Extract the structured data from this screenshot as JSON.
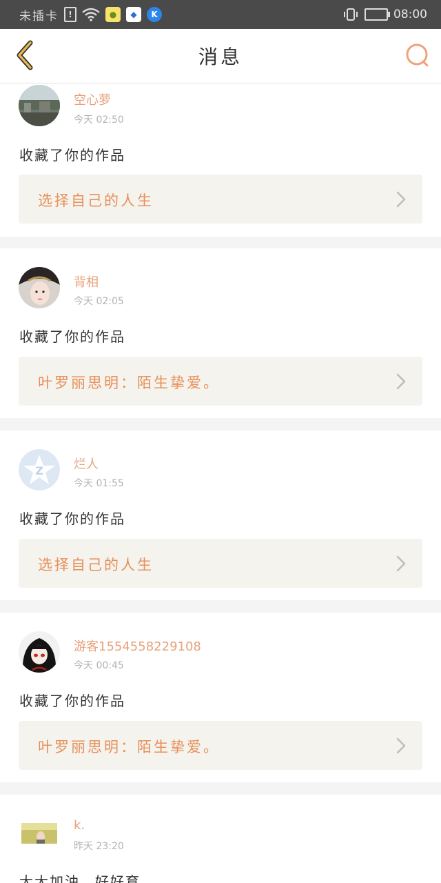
{
  "statusbar": {
    "carrier": "未插卡",
    "sim_mark": "!",
    "time": "08:00",
    "icons": [
      "sim-alert-icon",
      "wifi-icon",
      "chat-app-icon",
      "baidu-app-icon",
      "k-app-icon",
      "vibrate-icon",
      "battery-charging-icon"
    ]
  },
  "header": {
    "title": "消息",
    "back_icon": "chevron-left-icon",
    "search_icon": "search-icon"
  },
  "colors": {
    "accent": "#e88f58",
    "username": "#e6a27a",
    "back": "#e8b84a"
  },
  "messages": [
    {
      "username": "空心萝",
      "time": "今天 02:50",
      "action": "收藏了你的作品",
      "work_title": "选择自己的人生"
    },
    {
      "username": "背相",
      "time": "今天 02:05",
      "action": "收藏了你的作品",
      "work_title": "叶罗丽思明：陌生挚爱。"
    },
    {
      "username": "烂人",
      "time": "今天 01:55",
      "action": "收藏了你的作品",
      "work_title": "选择自己的人生"
    },
    {
      "username": "游客1554558229108",
      "time": "今天 00:45",
      "action": "收藏了你的作品",
      "work_title": "叶罗丽思明：陌生挚爱。"
    },
    {
      "username": "k.",
      "time": "昨天 23:20",
      "action": "大大加油，好好育"
    }
  ]
}
